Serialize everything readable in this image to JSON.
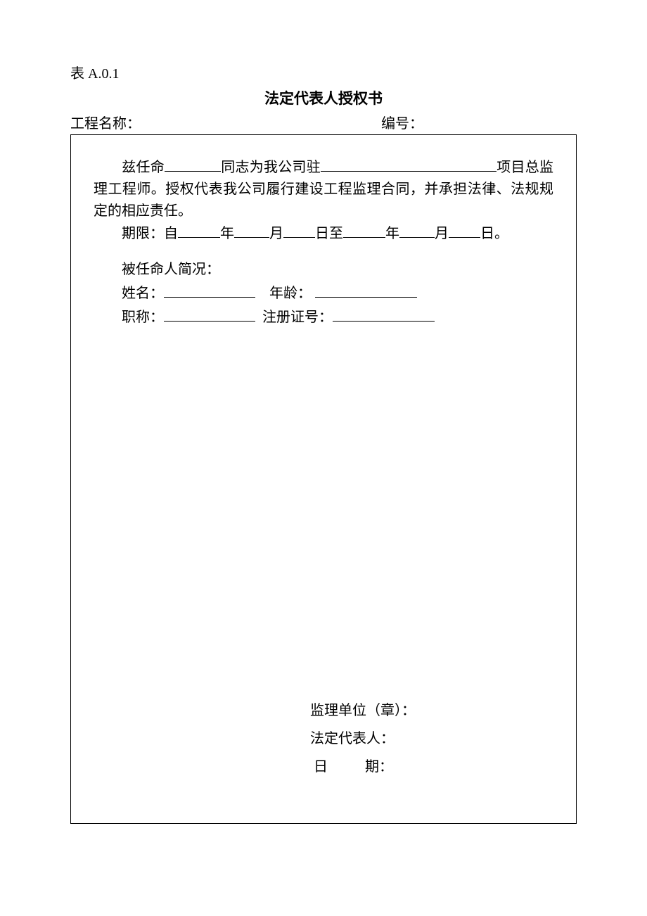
{
  "tableId": "表 A.0.1",
  "title": "法定代表人授权书",
  "header": {
    "projectLabel": "工程名称：",
    "serialLabel": "编号："
  },
  "body": {
    "appoint_pre": "兹任命",
    "appoint_mid": "同志为我公司驻",
    "appoint_tail": "项目总监理工程师。授权代表我公司履行建设工程监理合同，并承担法律、法规规定的相应责任。",
    "period_pre": "期限：自",
    "year": "年",
    "month": "月",
    "day_to": "日至",
    "day_end": "日。",
    "brief_label": "被任命人简况：",
    "name_label": "姓名：",
    "age_label": "年龄：",
    "title_label": "职称：",
    "regno_label": "注册证号："
  },
  "signature": {
    "org_label": "监理单位（章）：",
    "rep_label": "法定代表人：",
    "date_label_d": "日",
    "date_label_q": "期："
  }
}
